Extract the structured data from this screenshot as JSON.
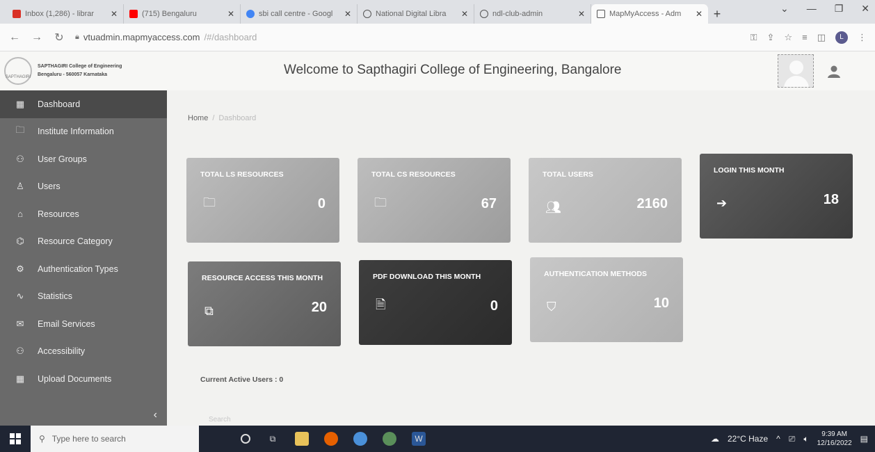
{
  "browser": {
    "tabs": [
      {
        "title": "Inbox (1,286) - librar",
        "color": "#d93025"
      },
      {
        "title": "(715) Bengaluru",
        "color": "#ff0000"
      },
      {
        "title": "sbi call centre - Googl",
        "color": "#4285f4"
      },
      {
        "title": "National Digital Libra",
        "color": "#555555"
      },
      {
        "title": "ndl-club-admin",
        "color": "#555555"
      },
      {
        "title": "MapMyAccess - Adm",
        "color": "#555555"
      }
    ],
    "url_host": "vtuadmin.mapmyaccess.com",
    "url_path": "/#/dashboard",
    "profile_initial": "L"
  },
  "header": {
    "college_line1": "SAPTHAGIRI College of Engineering",
    "college_line2": "Bengaluru - 560057 Karnataka",
    "logo_text": "SAPTHAGIRI",
    "welcome": "Welcome to Sapthagiri College of Engineering, Bangalore"
  },
  "sidebar": {
    "items": [
      {
        "label": "Dashboard",
        "icon": "grid-icon",
        "active": true
      },
      {
        "label": "Institute Information",
        "icon": "folder-icon"
      },
      {
        "label": "User Groups",
        "icon": "users-icon"
      },
      {
        "label": "Users",
        "icon": "user-icon"
      },
      {
        "label": "Resources",
        "icon": "bank-icon"
      },
      {
        "label": "Resource Category",
        "icon": "tag-icon"
      },
      {
        "label": "Authentication Types",
        "icon": "gear-icon"
      },
      {
        "label": "Statistics",
        "icon": "chart-icon"
      },
      {
        "label": "Email Services",
        "icon": "mail-icon"
      },
      {
        "label": "Accessibility",
        "icon": "accessibility-icon"
      },
      {
        "label": "Upload Documents",
        "icon": "upload-icon"
      }
    ]
  },
  "breadcrumb": {
    "home": "Home",
    "current": "Dashboard"
  },
  "cards": [
    {
      "title": "TOTAL LS RESOURCES",
      "value": "0",
      "icon": "folder-icon"
    },
    {
      "title": "TOTAL CS RESOURCES",
      "value": "67",
      "icon": "folder-icon"
    },
    {
      "title": "TOTAL USERS",
      "value": "2160",
      "icon": "users-icon"
    },
    {
      "title": "LOGIN THIS MONTH",
      "value": "18",
      "icon": "sign-in-icon"
    },
    {
      "title": "RESOURCE ACCESS THIS MONTH",
      "value": "20",
      "icon": "copy-icon"
    },
    {
      "title": "PDF DOWNLOAD THIS MONTH",
      "value": "0",
      "icon": "pdf-icon"
    },
    {
      "title": "AUTHENTICATION METHODS",
      "value": "10",
      "icon": "shield-icon"
    }
  ],
  "active_users": "Current Active Users : 0",
  "search_hint": "Search",
  "taskbar": {
    "search_placeholder": "Type here to search",
    "weather": "22°C  Haze",
    "time": "9:39 AM",
    "date": "12/16/2022"
  }
}
